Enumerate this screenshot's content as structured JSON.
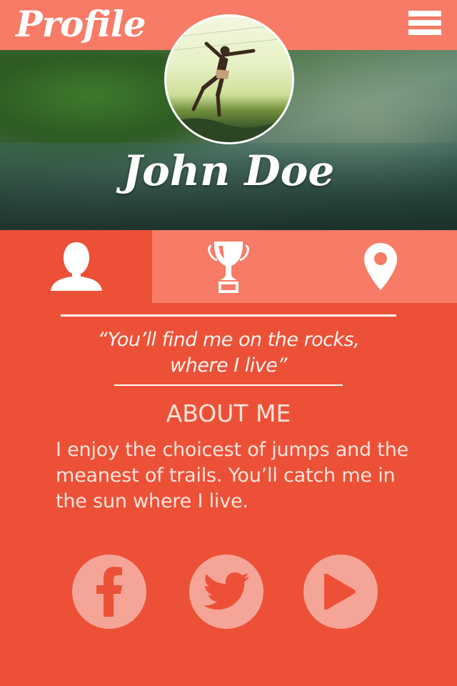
{
  "header": {
    "title": "Profile",
    "menu_icon": "hamburger-menu-icon"
  },
  "profile": {
    "name": "John Doe",
    "avatar": "profile-photo"
  },
  "tabs": [
    {
      "icon": "user-icon",
      "active": true
    },
    {
      "icon": "trophy-icon",
      "active": false
    },
    {
      "icon": "location-pin-icon",
      "active": false
    }
  ],
  "quote": {
    "line1": "“You’ll find me on the rocks,",
    "line2": "where I live”"
  },
  "about": {
    "heading": "ABOUT ME",
    "text": "I enjoy the choicest of jumps and the meanest of trails. You’ll catch me in the sun where I live."
  },
  "social": [
    {
      "icon": "facebook-icon"
    },
    {
      "icon": "twitter-icon"
    },
    {
      "icon": "play-icon"
    }
  ],
  "colors": {
    "background": "#ec5137",
    "header": "#f77b66",
    "tab_inactive": "#f77b66",
    "social_circle": "#f5a597",
    "text": "#ffffff"
  }
}
